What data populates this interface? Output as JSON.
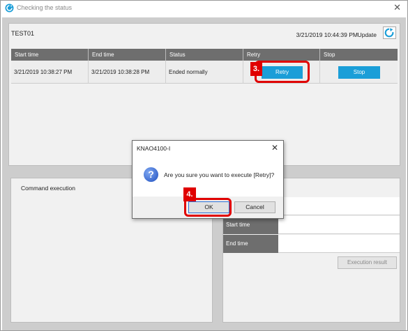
{
  "window": {
    "title": "Checking the status"
  },
  "panel": {
    "name": "TEST01",
    "updated_time": "3/21/2019 10:44:39 PM",
    "update_label": "Update"
  },
  "grid": {
    "columns": [
      "Start time",
      "End time",
      "Status",
      "Retry",
      "Stop"
    ],
    "rows": [
      {
        "start_time": "3/21/2019 10:38:27 PM",
        "end_time": "3/21/2019 10:38:28 PM",
        "status": "Ended normally",
        "retry_label": "Retry",
        "stop_label": "Stop"
      }
    ]
  },
  "command_execution": {
    "label": "Command execution"
  },
  "details": {
    "start_time_label": "Start time",
    "end_time_label": "End time",
    "execution_result_label": "Execution result"
  },
  "dialog": {
    "title": "KNAO4100-I",
    "message": "Are you sure you want to execute [Retry]?",
    "ok_label": "OK",
    "cancel_label": "Cancel"
  },
  "callouts": {
    "step3": "3.",
    "step4": "4."
  },
  "colors": {
    "accent": "#1a9ed8",
    "header": "#6e6e6e",
    "callout": "#e00000"
  }
}
